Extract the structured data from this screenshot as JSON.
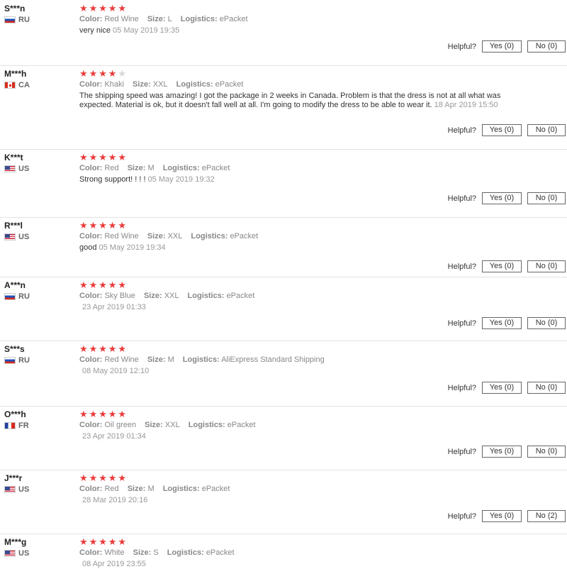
{
  "reviews": [
    {
      "user": "S***n",
      "country": "RU",
      "stars": 5,
      "color_label": "Color:",
      "color": "Red Wine",
      "size_label": "Size:",
      "size": "L",
      "logistics_label": "Logistics:",
      "logistics": "ePacket",
      "text": "very nice",
      "date": "05 May 2019 19:35",
      "helpful_label": "Helpful?",
      "yes": "Yes (0)",
      "no": "No (0)"
    },
    {
      "user": "M***h",
      "country": "CA",
      "stars": 4,
      "color_label": "Color:",
      "color": "Khaki",
      "size_label": "Size:",
      "size": "XXL",
      "logistics_label": "Logistics:",
      "logistics": "ePacket",
      "text": "The shipping speed was amazing! I got the package in 2 weeks in Canada. Problem is that the dress is not at all what was expected. Material is ok, but it doesn't fall well at all. I'm going to modify the dress to be able to wear it.",
      "date": "18 Apr 2019 15:50",
      "helpful_label": "Helpful?",
      "yes": "Yes (0)",
      "no": "No (0)"
    },
    {
      "user": "K***t",
      "country": "US",
      "stars": 5,
      "color_label": "Color:",
      "color": "Red",
      "size_label": "Size:",
      "size": "M",
      "logistics_label": "Logistics:",
      "logistics": "ePacket",
      "text": "Strong support! ! ! !",
      "date": "05 May 2019 19:32",
      "helpful_label": "Helpful?",
      "yes": "Yes (0)",
      "no": "No (0)"
    },
    {
      "user": "R***l",
      "country": "US",
      "stars": 5,
      "color_label": "Color:",
      "color": "Red Wine",
      "size_label": "Size:",
      "size": "XXL",
      "logistics_label": "Logistics:",
      "logistics": "ePacket",
      "text": "good",
      "date": "05 May 2019 19:34",
      "helpful_label": "Helpful?",
      "yes": "Yes (0)",
      "no": "No (0)"
    },
    {
      "user": "A***n",
      "country": "RU",
      "stars": 5,
      "color_label": "Color:",
      "color": "Sky Blue",
      "size_label": "Size:",
      "size": "XXL",
      "logistics_label": "Logistics:",
      "logistics": "ePacket",
      "text": "",
      "date": "23 Apr 2019 01:33",
      "helpful_label": "Helpful?",
      "yes": "Yes (0)",
      "no": "No (0)"
    },
    {
      "user": "S***s",
      "country": "RU",
      "stars": 5,
      "color_label": "Color:",
      "color": "Red Wine",
      "size_label": "Size:",
      "size": "M",
      "logistics_label": "Logistics:",
      "logistics": "AliExpress Standard Shipping",
      "text": "",
      "date": "08 May 2019 12:10",
      "helpful_label": "Helpful?",
      "yes": "Yes (0)",
      "no": "No (0)"
    },
    {
      "user": "O***h",
      "country": "FR",
      "stars": 5,
      "color_label": "Color:",
      "color": "Oil green",
      "size_label": "Size:",
      "size": "XXL",
      "logistics_label": "Logistics:",
      "logistics": "ePacket",
      "text": "",
      "date": "23 Apr 2019 01:34",
      "helpful_label": "Helpful?",
      "yes": "Yes (0)",
      "no": "No (0)"
    },
    {
      "user": "J***r",
      "country": "US",
      "stars": 5,
      "color_label": "Color:",
      "color": "Red",
      "size_label": "Size:",
      "size": "M",
      "logistics_label": "Logistics:",
      "logistics": "ePacket",
      "text": "",
      "date": "28 Mar 2019 20:16",
      "helpful_label": "Helpful?",
      "yes": "Yes (0)",
      "no": "No (2)"
    },
    {
      "user": "M***g",
      "country": "US",
      "stars": 5,
      "color_label": "Color:",
      "color": "White",
      "size_label": "Size:",
      "size": "S",
      "logistics_label": "Logistics:",
      "logistics": "ePacket",
      "text": "",
      "date": "08 Apr 2019 23:55",
      "helpful_label": "Helpful?",
      "yes": "",
      "no": ""
    }
  ],
  "colors": {
    "star": "#ea3a3a",
    "star_off": "#d6d6d6"
  }
}
